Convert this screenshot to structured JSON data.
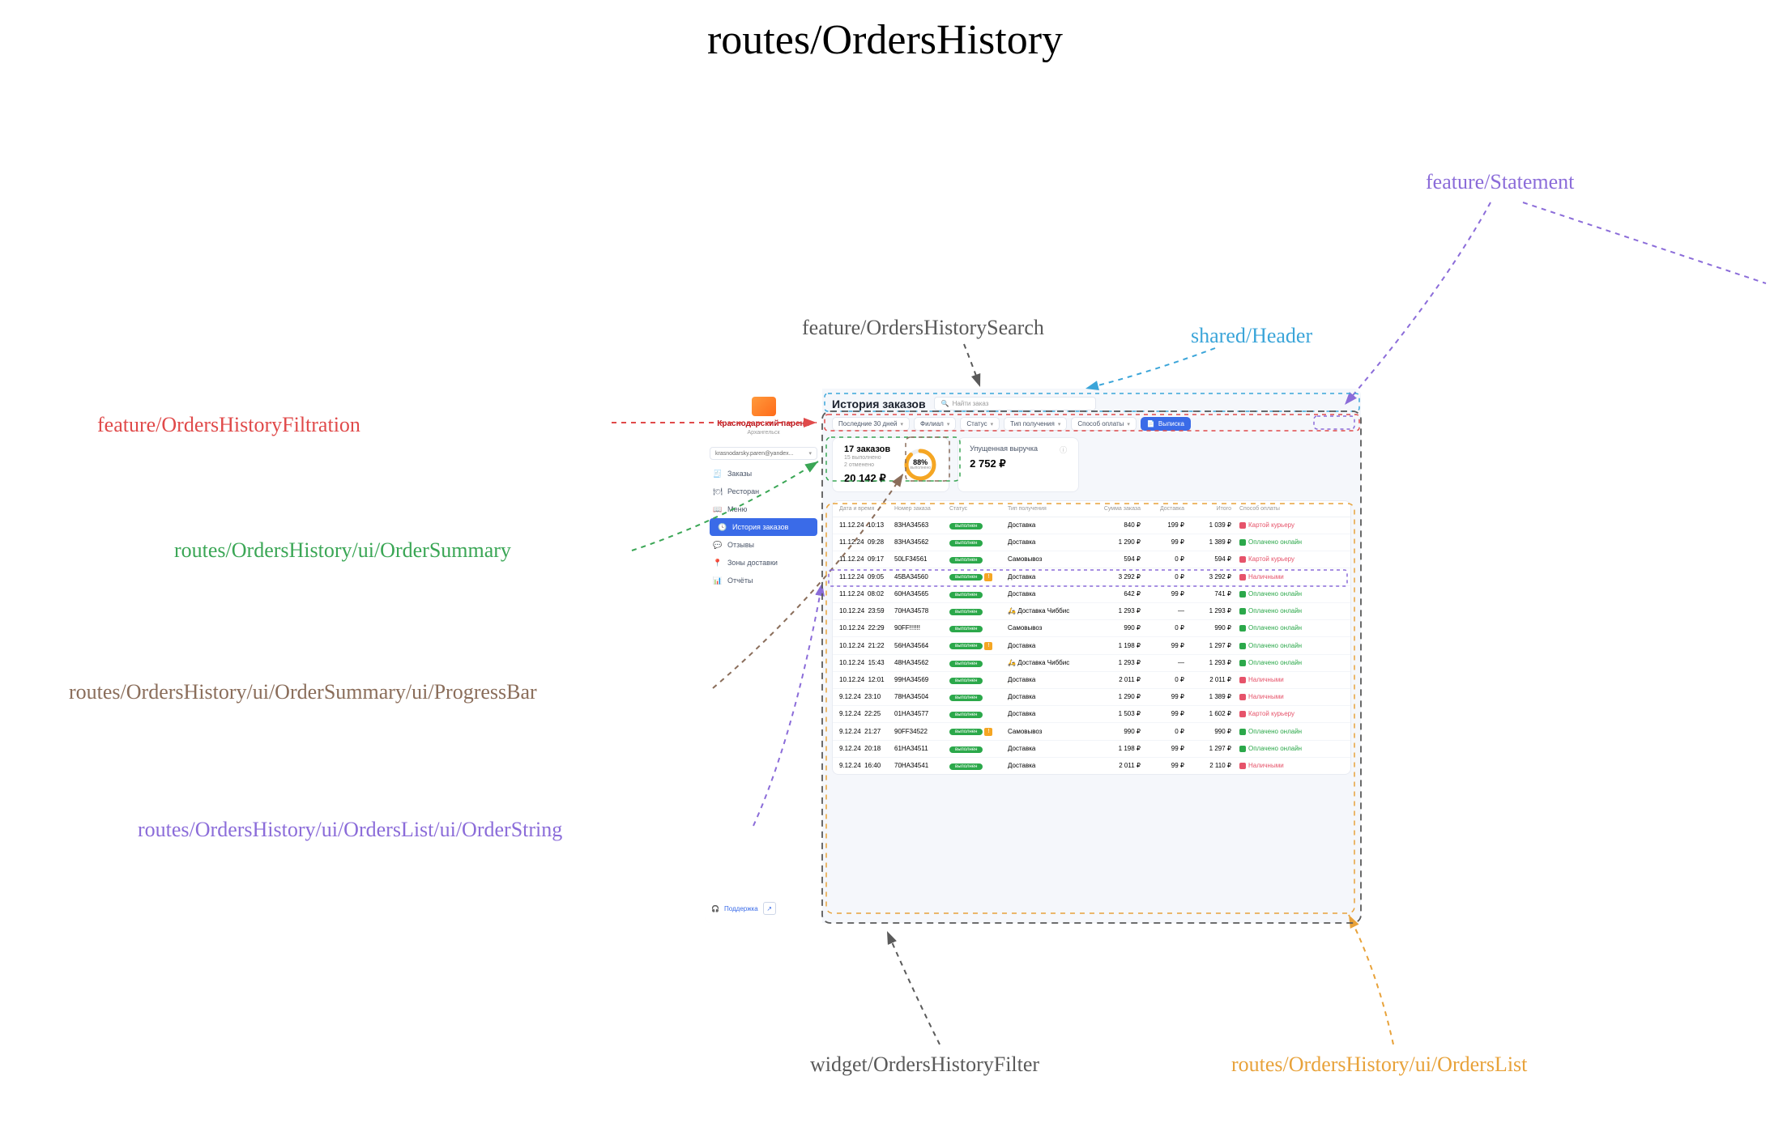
{
  "diagram_title": "routes/OrdersHistory",
  "annotations": {
    "statement": "feature/Statement",
    "shared_header": "shared/Header",
    "search": "feature/OrdersHistorySearch",
    "filtration": "feature/OrdersHistoryFiltration",
    "summary": "routes/OrdersHistory/ui/OrderSummary",
    "progress": "routes/OrdersHistory/ui/OrderSummary/ui/ProgressBar",
    "orderstring": "routes/OrdersHistory/ui/OrdersList/ui/OrderString",
    "filter_widget": "widget/OrdersHistoryFilter",
    "orderslist": "routes/OrdersHistory/ui/OrdersList"
  },
  "brand": {
    "name": "Краснодарский парень",
    "city": "Архангельск",
    "email": "krasnodarsky.paren@yandex..."
  },
  "nav": {
    "orders": "Заказы",
    "restaurant": "Ресторан",
    "menu": "Меню",
    "history": "История заказов",
    "reviews": "Отзывы",
    "zones": "Зоны доставки",
    "reports": "Отчёты",
    "support": "Поддержка"
  },
  "header": {
    "title": "История заказов",
    "search_placeholder": "Найти заказ"
  },
  "filters": {
    "period": "Последние 30 дней",
    "branch": "Филиал",
    "status": "Статус",
    "receive": "Тип получения",
    "payment": "Способ оплаты",
    "statement": "Выписка"
  },
  "summary": {
    "count_label": "17 заказов",
    "done_label": "15 выполнено",
    "cancel_label": "2 отменено",
    "total": "20 142 ₽",
    "percent": "88%",
    "percent_sub": "выполнено",
    "lost_title": "Упущенная выручка",
    "lost_amount": "2 752 ₽"
  },
  "table": {
    "headers": {
      "dt": "Дата и время",
      "num": "Номер заказа",
      "status": "Статус",
      "type": "Тип получения",
      "sum": "Сумма заказа",
      "del": "Доставка",
      "total": "Итого",
      "pay": "Способ оплаты"
    },
    "status_done": "выполнен"
  },
  "orders": [
    {
      "d": "11.12.24",
      "t": "10:13",
      "n": "83HA34563",
      "warn": false,
      "type": "Доставка",
      "chibbis": false,
      "sum": "840 ₽",
      "del": "199 ₽",
      "tot": "1 039 ₽",
      "pay": "Картой курьеру",
      "pk": "card"
    },
    {
      "d": "11.12.24",
      "t": "09:28",
      "n": "83HA34562",
      "warn": false,
      "type": "Доставка",
      "chibbis": false,
      "sum": "1 290 ₽",
      "del": "99 ₽",
      "tot": "1 389 ₽",
      "pay": "Оплачено онлайн",
      "pk": "online"
    },
    {
      "d": "11.12.24",
      "t": "09:17",
      "n": "50LF34561",
      "warn": false,
      "type": "Самовывоз",
      "chibbis": false,
      "sum": "594 ₽",
      "del": "0 ₽",
      "tot": "594 ₽",
      "pay": "Картой курьеру",
      "pk": "card"
    },
    {
      "d": "11.12.24",
      "t": "09:05",
      "n": "45BA34560",
      "warn": true,
      "type": "Доставка",
      "chibbis": false,
      "sum": "3 292 ₽",
      "del": "0 ₽",
      "tot": "3 292 ₽",
      "pay": "Наличными",
      "pk": "cash"
    },
    {
      "d": "11.12.24",
      "t": "08:02",
      "n": "60HA34565",
      "warn": false,
      "type": "Доставка",
      "chibbis": false,
      "sum": "642 ₽",
      "del": "99 ₽",
      "tot": "741 ₽",
      "pay": "Оплачено онлайн",
      "pk": "online"
    },
    {
      "d": "10.12.24",
      "t": "23:59",
      "n": "70HA34578",
      "warn": false,
      "type": "Доставка Чиббис",
      "chibbis": true,
      "sum": "1 293 ₽",
      "del": "—",
      "tot": "1 293 ₽",
      "pay": "Оплачено онлайн",
      "pk": "online"
    },
    {
      "d": "10.12.24",
      "t": "22:29",
      "n": "90FF!!!!!!",
      "warn": false,
      "type": "Самовывоз",
      "chibbis": false,
      "sum": "990 ₽",
      "del": "0 ₽",
      "tot": "990 ₽",
      "pay": "Оплачено онлайн",
      "pk": "online"
    },
    {
      "d": "10.12.24",
      "t": "21:22",
      "n": "56HA34564",
      "warn": true,
      "type": "Доставка",
      "chibbis": false,
      "sum": "1 198 ₽",
      "del": "99 ₽",
      "tot": "1 297 ₽",
      "pay": "Оплачено онлайн",
      "pk": "online"
    },
    {
      "d": "10.12.24",
      "t": "15:43",
      "n": "48HA34562",
      "warn": false,
      "type": "Доставка Чиббис",
      "chibbis": true,
      "sum": "1 293 ₽",
      "del": "—",
      "tot": "1 293 ₽",
      "pay": "Оплачено онлайн",
      "pk": "online"
    },
    {
      "d": "10.12.24",
      "t": "12:01",
      "n": "99HA34569",
      "warn": false,
      "type": "Доставка",
      "chibbis": false,
      "sum": "2 011 ₽",
      "del": "0 ₽",
      "tot": "2 011 ₽",
      "pay": "Наличными",
      "pk": "cash"
    },
    {
      "d": "9.12.24",
      "t": "23:10",
      "n": "78HA34504",
      "warn": false,
      "type": "Доставка",
      "chibbis": false,
      "sum": "1 290 ₽",
      "del": "99 ₽",
      "tot": "1 389 ₽",
      "pay": "Наличными",
      "pk": "cash"
    },
    {
      "d": "9.12.24",
      "t": "22:25",
      "n": "01HA34577",
      "warn": false,
      "type": "Доставка",
      "chibbis": false,
      "sum": "1 503 ₽",
      "del": "99 ₽",
      "tot": "1 602 ₽",
      "pay": "Картой курьеру",
      "pk": "card"
    },
    {
      "d": "9.12.24",
      "t": "21:27",
      "n": "90FF34522",
      "warn": true,
      "type": "Самовывоз",
      "chibbis": false,
      "sum": "990 ₽",
      "del": "0 ₽",
      "tot": "990 ₽",
      "pay": "Оплачено онлайн",
      "pk": "online"
    },
    {
      "d": "9.12.24",
      "t": "20:18",
      "n": "61HA34511",
      "warn": false,
      "type": "Доставка",
      "chibbis": false,
      "sum": "1 198 ₽",
      "del": "99 ₽",
      "tot": "1 297 ₽",
      "pay": "Оплачено онлайн",
      "pk": "online"
    },
    {
      "d": "9.12.24",
      "t": "16:40",
      "n": "70HA34541",
      "warn": false,
      "type": "Доставка",
      "chibbis": false,
      "sum": "2 011 ₽",
      "del": "99 ₽",
      "tot": "2 110 ₽",
      "pay": "Наличными",
      "pk": "cash"
    }
  ],
  "colors": {
    "statement": "#8b6cd9",
    "header": "#3ba5d9",
    "search": "#5a5a5a",
    "filtration": "#e04a4a",
    "summary": "#3aa655",
    "progress": "#8a6d5a",
    "orderstring": "#8b6cd9",
    "filter_widget": "#5a5a5a",
    "orderslist": "#e8a23a"
  }
}
